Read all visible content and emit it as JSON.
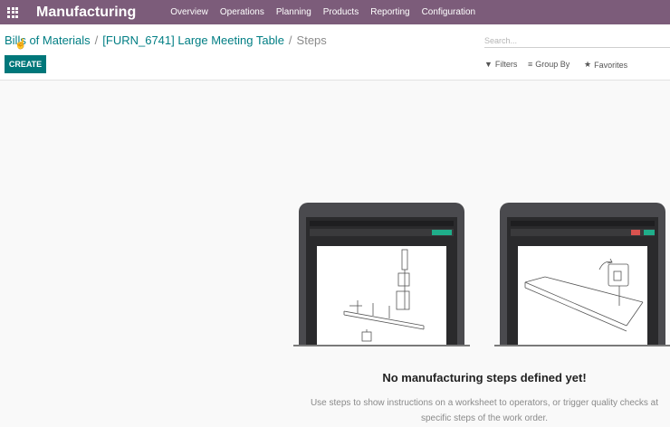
{
  "topbar": {
    "app_title": "Manufacturing",
    "menu": [
      "Overview",
      "Operations",
      "Planning",
      "Products",
      "Reporting",
      "Configuration"
    ]
  },
  "breadcrumb": {
    "items": [
      "Bills of Materials",
      "[FURN_6741] Large Meeting Table"
    ],
    "current": "Steps",
    "separator": "/"
  },
  "search": {
    "placeholder": "Search..."
  },
  "toolbar": {
    "create_label": "CREATE"
  },
  "filters": {
    "filters_label": "Filters",
    "group_by_label": "Group By",
    "favorites_label": "Favorites"
  },
  "empty_state": {
    "title": "No manufacturing steps defined yet!",
    "description": "Use steps to show instructions on a worksheet to operators, or trigger quality checks at specific steps of the work order."
  },
  "colors": {
    "topbar": "#7c5c7a",
    "primary": "#00777a",
    "link": "#017e84"
  },
  "icons": [
    "apps-grid-icon",
    "filter-icon",
    "group-by-icon",
    "star-icon",
    "pointer-cursor-icon"
  ]
}
